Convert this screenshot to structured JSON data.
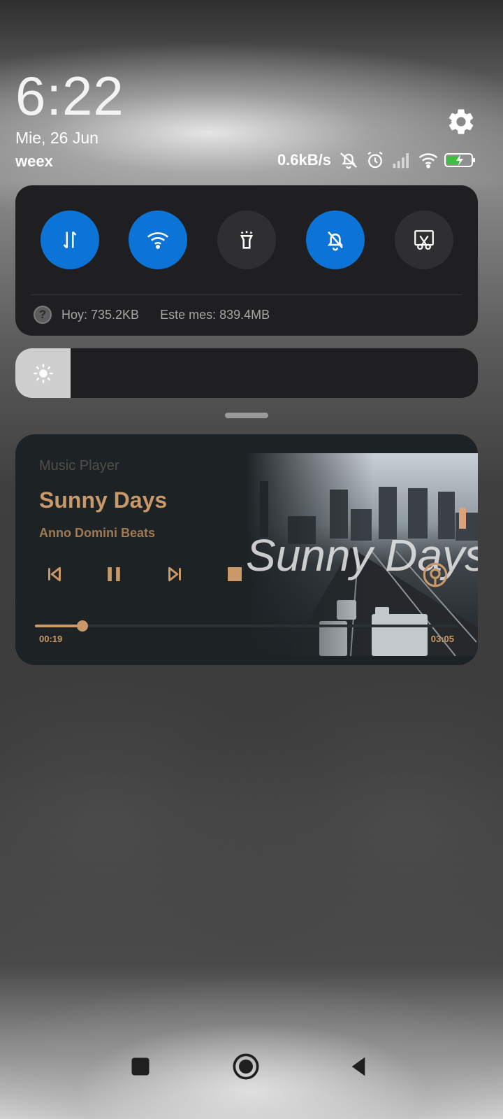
{
  "header": {
    "time": "6:22",
    "date": "Mie, 26 Jun",
    "carrier": "weex",
    "net_speed": "0.6kB/s"
  },
  "status_icons": [
    "notifications-off-icon",
    "alarm-icon",
    "signal-icon",
    "wifi-icon",
    "battery-charging-icon"
  ],
  "quick_settings": {
    "tiles": [
      {
        "name": "mobile-data",
        "icon": "data-arrows-icon",
        "active": true
      },
      {
        "name": "wifi",
        "icon": "wifi-icon",
        "active": true
      },
      {
        "name": "flashlight",
        "icon": "flashlight-icon",
        "active": false
      },
      {
        "name": "mute",
        "icon": "bell-off-icon",
        "active": true
      },
      {
        "name": "screenshot",
        "icon": "scissors-icon",
        "active": false
      }
    ],
    "usage_today": "Hoy: 735.2KB",
    "usage_month": "Este mes: 839.4MB",
    "active_color": "#0c74d6"
  },
  "brightness": {
    "level": 0.12
  },
  "media": {
    "app": "Music Player",
    "title": "Sunny Days",
    "artist": "Anno Domini Beats",
    "elapsed": "00:19",
    "total": "03:05",
    "progress": 0.103,
    "art_text": "Sunny Days",
    "accent": "#c9996a"
  },
  "nav": [
    "recents-button",
    "home-button",
    "back-button"
  ]
}
